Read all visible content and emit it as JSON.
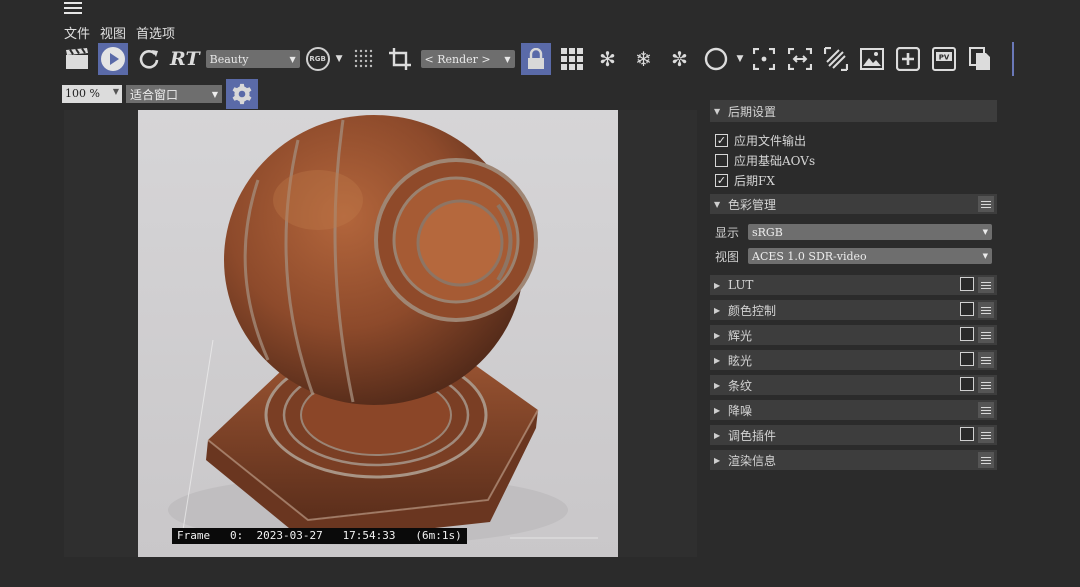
{
  "menu": {
    "file": "文件",
    "view": "视图",
    "prefs": "首选项"
  },
  "toolbar": {
    "rt_label": "RT",
    "pass_select": "Beauty",
    "rgb_badge": "RGB",
    "render_select": "< Render >",
    "zoom_value": "100 %",
    "fit_select": "适合窗口"
  },
  "viewport": {
    "frame_info": "Frame   0:  2023-03-27   17:54:33   (6m:1s)"
  },
  "panel": {
    "top_section": "后期设置",
    "checkboxes": [
      {
        "label": "应用文件输出",
        "checked": true
      },
      {
        "label": "应用基础AOVs",
        "checked": false
      },
      {
        "label": "后期FX",
        "checked": true
      }
    ],
    "color_mgmt": {
      "title": "色彩管理",
      "display_label": "显示",
      "display_value": "sRGB",
      "view_label": "视图",
      "view_value": "ACES 1.0 SDR-video"
    },
    "sections": [
      {
        "label": "LUT",
        "has_checkbox": true
      },
      {
        "label": "颜色控制",
        "has_checkbox": true
      },
      {
        "label": "辉光",
        "has_checkbox": true
      },
      {
        "label": "眩光",
        "has_checkbox": true
      },
      {
        "label": "条纹",
        "has_checkbox": true
      },
      {
        "label": "降噪",
        "has_checkbox": false
      },
      {
        "label": "调色插件",
        "has_checkbox": true
      },
      {
        "label": "渲染信息",
        "has_checkbox": false
      }
    ]
  },
  "colors": {
    "accent": "#5a6aa8",
    "bg": "#2b2b2b",
    "panel_header": "#3d3d3d"
  }
}
